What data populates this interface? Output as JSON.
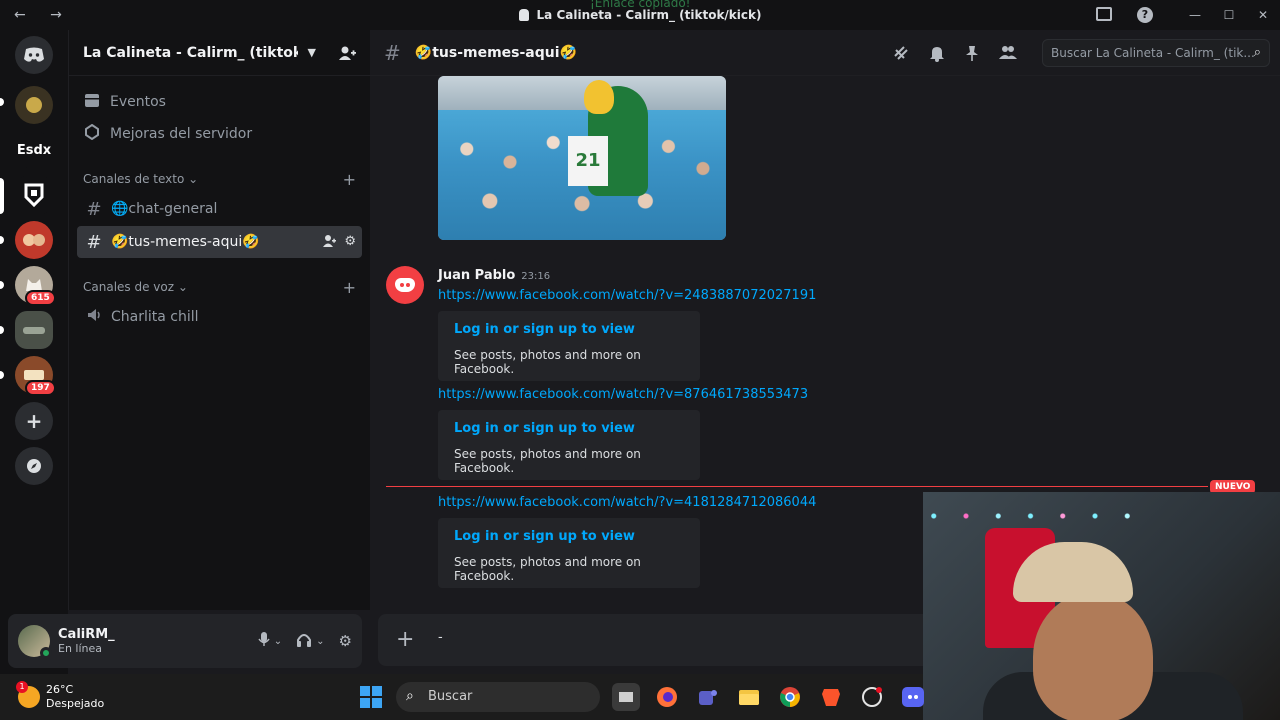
{
  "window": {
    "title": "La Calineta - Calirm_ (tiktok/kick)",
    "toast": "¡Enlace copiado!",
    "nav_arrows": "← →",
    "controls": [
      "—",
      "☐",
      "✕"
    ]
  },
  "guilds": {
    "esdx_label": "Esdx",
    "badge_615": "615",
    "badge_197": "197"
  },
  "server": {
    "name": "La Calineta - Calirm_ (tiktok/ki...",
    "events": "Eventos",
    "boosts": "Mejoras del servidor",
    "text_category": "Canales de texto",
    "voice_category": "Canales de voz",
    "channels": [
      {
        "name": "🌐chat-general"
      },
      {
        "name": "🤣tus-memes-aqui🤣"
      }
    ],
    "voice_channels": [
      {
        "name": "Charlita chill"
      }
    ]
  },
  "user": {
    "name": "CaliRM_",
    "status": "En línea"
  },
  "channel_header": {
    "name": "🤣tus-memes-aqui🤣",
    "search_placeholder": "Buscar La Calineta - Calirm_ (tik..."
  },
  "message": {
    "author": "Juan Pablo",
    "time": "23:16",
    "image_number": "21",
    "links": [
      "https://www.facebook.com/watch/?v=2483887072027191",
      "https://www.facebook.com/watch/?v=876461738553473",
      "https://www.facebook.com/watch/?v=4181284712086044"
    ],
    "embed_title": "Log in or sign up to view",
    "embed_desc": "See posts, photos and more on Facebook."
  },
  "new_divider": "NUEVO",
  "composer": {
    "text": "-"
  },
  "taskbar": {
    "temp": "26°C",
    "weather": "Despejado",
    "weather_badge": "1",
    "search": "Buscar"
  },
  "colors": {
    "accent_red": "#f23f43",
    "link": "#00a8fc",
    "online": "#23a55a"
  }
}
